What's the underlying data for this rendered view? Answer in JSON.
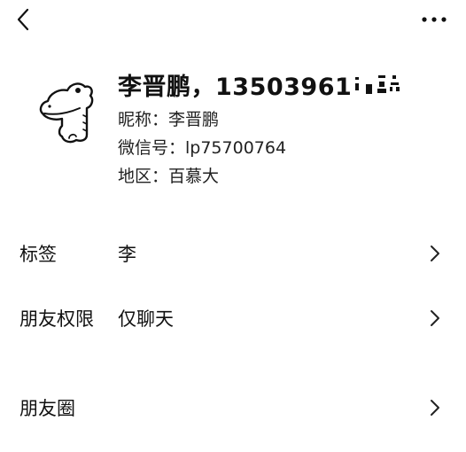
{
  "topbar": {
    "back_icon": "chevron-left-icon",
    "more_icon": "more-horizontal-icon"
  },
  "profile": {
    "name": "李晋鹏，13503961",
    "nickname": "昵称：李晋鹏",
    "wechat_id": "微信号：lp75700764",
    "region": "地区：百慕大",
    "avatar_icon": "crocodile-cartoon-avatar"
  },
  "rows": [
    {
      "label": "标签",
      "value": "李",
      "chevron_icon": "chevron-right-icon"
    },
    {
      "label": "朋友权限",
      "value": "仅聊天",
      "chevron_icon": "chevron-right-icon"
    },
    {
      "label": "朋友圈",
      "value": "",
      "chevron_icon": "chevron-right-icon"
    }
  ]
}
